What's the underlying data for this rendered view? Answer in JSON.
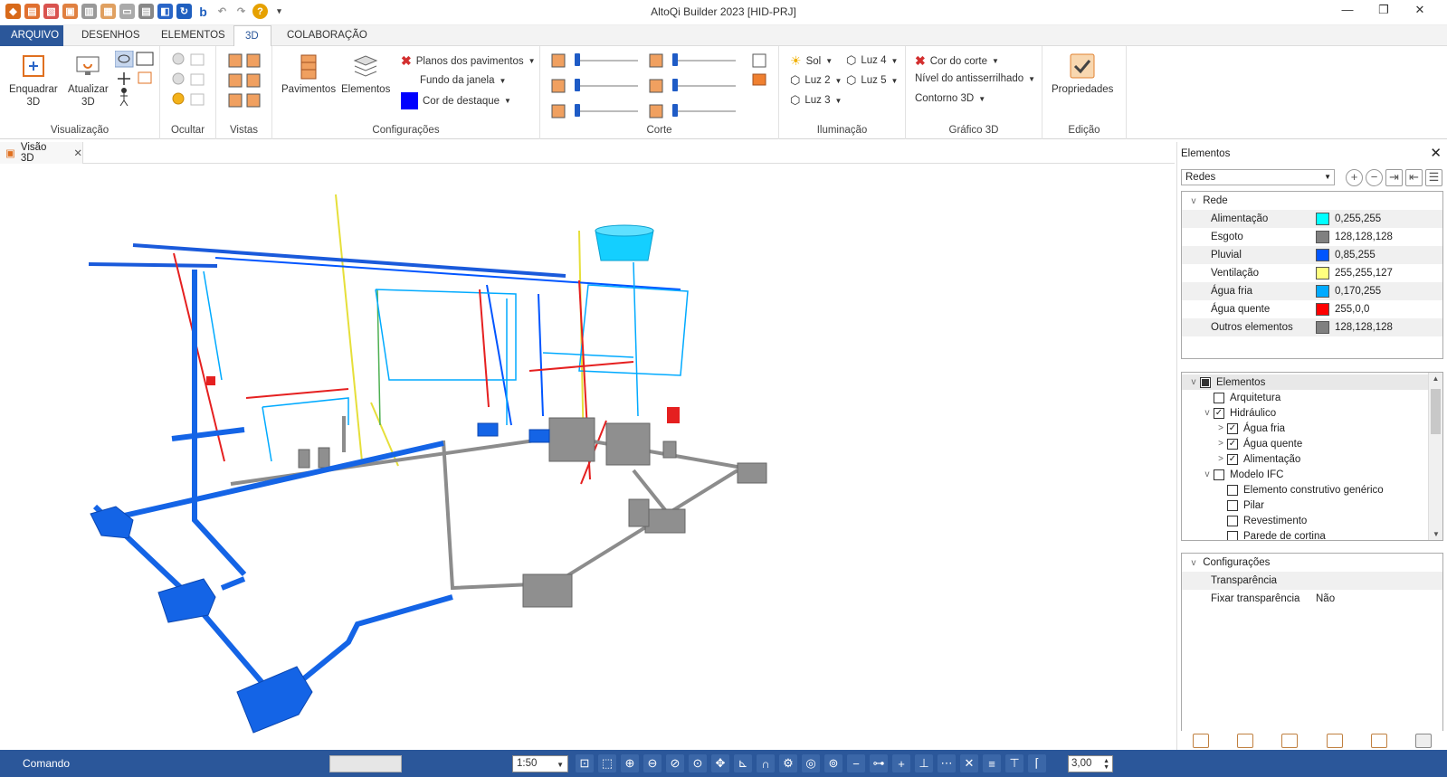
{
  "window": {
    "title": "AltoQi Builder 2023 [HID-PRJ]",
    "controls": [
      "—",
      "❐",
      "✕"
    ]
  },
  "menu": {
    "tabs": [
      "ARQUIVO",
      "DESENHOS",
      "ELEMENTOS",
      "3D",
      "COLABORAÇÃO"
    ],
    "active": "3D"
  },
  "ribbon": {
    "visualizacao": {
      "label": "Visualização",
      "enquadrar": "Enquadrar\n3D",
      "atualizar": "Atualizar\n3D"
    },
    "ocultar": {
      "label": "Ocultar"
    },
    "vistas": {
      "label": "Vistas"
    },
    "configuracoes": {
      "label": "Configurações",
      "pavimentos": "Pavimentos",
      "elementos": "Elementos",
      "planos": "Planos dos pavimentos",
      "fundo": "Fundo da janela",
      "destaque": "Cor de destaque",
      "destaque_color": "#0000ff"
    },
    "corte": {
      "label": "Corte"
    },
    "iluminacao": {
      "label": "Iluminação",
      "sol": "Sol",
      "luz2": "Luz 2",
      "luz3": "Luz 3",
      "luz4": "Luz 4",
      "luz5": "Luz 5"
    },
    "grafico3d": {
      "label": "Gráfico 3D",
      "cor_corte": "Cor do corte",
      "antisserrilhado": "Nível do antisserrilhado",
      "contorno": "Contorno 3D"
    },
    "edicao": {
      "label": "Edição",
      "propriedades": "Propriedades"
    }
  },
  "document": {
    "tab": "Visão 3D"
  },
  "panel": {
    "title": "Elementos",
    "combo": "Redes",
    "rede_section": "Rede",
    "rede": [
      {
        "name": "Alimentação",
        "value": "0,255,255",
        "color": "#00ffff"
      },
      {
        "name": "Esgoto",
        "value": "128,128,128",
        "color": "#808080"
      },
      {
        "name": "Pluvial",
        "value": "0,85,255",
        "color": "#0055ff"
      },
      {
        "name": "Ventilação",
        "value": "255,255,127",
        "color": "#ffff7f"
      },
      {
        "name": "Água fria",
        "value": "0,170,255",
        "color": "#00aaff"
      },
      {
        "name": "Água quente",
        "value": "255,0,0",
        "color": "#ff0000"
      },
      {
        "name": "Outros elementos",
        "value": "128,128,128",
        "color": "#808080"
      }
    ],
    "tree": [
      {
        "label": "Elementos",
        "level": 0,
        "check": "partial",
        "expander": "v"
      },
      {
        "label": "Arquitetura",
        "level": 1,
        "check": "off",
        "expander": ""
      },
      {
        "label": "Hidráulico",
        "level": 1,
        "check": "on",
        "expander": "v"
      },
      {
        "label": "Água fria",
        "level": 2,
        "check": "on",
        "expander": ">"
      },
      {
        "label": "Água quente",
        "level": 2,
        "check": "on",
        "expander": ">"
      },
      {
        "label": "Alimentação",
        "level": 2,
        "check": "on",
        "expander": ">"
      },
      {
        "label": "Modelo IFC",
        "level": 1,
        "check": "off",
        "expander": "v"
      },
      {
        "label": "Elemento construtivo genérico",
        "level": 2,
        "check": "off",
        "expander": ""
      },
      {
        "label": "Pilar",
        "level": 2,
        "check": "off",
        "expander": ""
      },
      {
        "label": "Revestimento",
        "level": 2,
        "check": "off",
        "expander": ""
      },
      {
        "label": "Parede de cortina",
        "level": 2,
        "check": "off",
        "expander": ""
      }
    ],
    "config_section": "Configurações",
    "config": [
      {
        "name": "Transparência",
        "value": ""
      },
      {
        "name": "Fixar transparência",
        "value": "Não"
      }
    ]
  },
  "status": {
    "label": "Comando",
    "scale": "1:50",
    "value": "3,00"
  }
}
